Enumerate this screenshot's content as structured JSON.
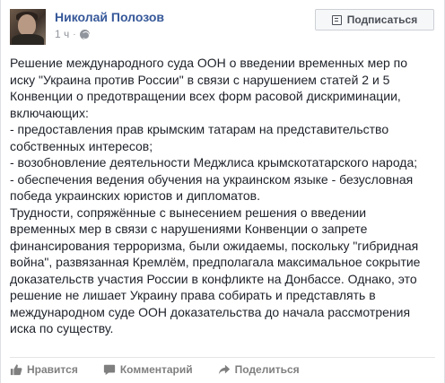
{
  "post": {
    "author": "Николай Полозов",
    "time": "1 ч",
    "dot": "·",
    "subscribe_label": "Подписаться",
    "lines": [
      "Решение международного суда ООН о введении временных мер по",
      "иску \"Украина против России\" в связи с нарушением статей 2 и 5",
      "Конвенции о предотвращении всех форм расовой дискриминации,",
      "включающих:",
      "- предоставления прав крымским татарам на представительство",
      "собственных интересов;",
      "- возобновление деятельности Меджлиса крымскотатарского народа;",
      "- обеспечения ведения обучения на украинском языке - безусловная",
      "победа украинских юристов и дипломатов.",
      "Трудности, сопряжённые с вынесением решения о введении",
      "временных мер в связи с нарушениями Конвенции о запрете",
      "финансирования терроризма, были ожидаемы, поскольку \"гибридная",
      "война\", развязанная Кремлём, предполагала максимальное сокрытие",
      "доказательств участия России в конфликте на Донбассе. Однако, это",
      "решение не лишает Украину права собирать и представлять в",
      "международном суде ООН доказательства до начала рассмотрения",
      "иска по существу."
    ]
  },
  "actions": {
    "like": "Нравится",
    "comment": "Комментарий",
    "share": "Поделиться"
  },
  "icons": {
    "globe": "globe-icon",
    "subscribe": "subscribe-icon",
    "like": "thumbs-up-icon",
    "comment": "comment-icon",
    "share": "share-arrow-icon"
  },
  "colors": {
    "author": "#365899",
    "meta": "#90949c",
    "text": "#1d2129",
    "action": "#7f7f7f"
  }
}
